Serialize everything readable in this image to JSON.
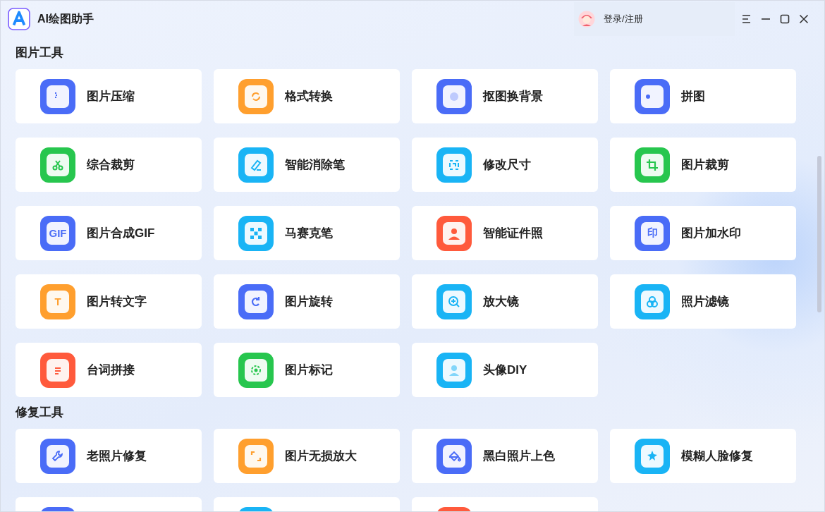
{
  "window": {
    "title": "AI绘图助手"
  },
  "account": {
    "label": "登录/注册"
  },
  "sections": [
    {
      "title": "图片工具",
      "tools": [
        {
          "label": "图片压缩",
          "color": "#4a6cf7",
          "kind": "file"
        },
        {
          "label": "格式转换",
          "color": "#ff9f2e",
          "kind": "refresh"
        },
        {
          "label": "抠图换背景",
          "color": "#4a6cf7",
          "kind": "cutout"
        },
        {
          "label": "拼图",
          "color": "#4a6cf7",
          "kind": "puzzle"
        },
        {
          "label": "综合裁剪",
          "color": "#27c64e",
          "kind": "scissors"
        },
        {
          "label": "智能消除笔",
          "color": "#19b4f5",
          "kind": "eraser"
        },
        {
          "label": "修改尺寸",
          "color": "#19b4f5",
          "kind": "resize"
        },
        {
          "label": "图片裁剪",
          "color": "#27c64e",
          "kind": "crop"
        },
        {
          "label": "图片合成GIF",
          "color": "#4a6cf7",
          "kind": "glyph",
          "glyph": "GIF"
        },
        {
          "label": "马赛克笔",
          "color": "#19b4f5",
          "kind": "mosaic"
        },
        {
          "label": "智能证件照",
          "color": "#ff5a3c",
          "kind": "person"
        },
        {
          "label": "图片加水印",
          "color": "#4a6cf7",
          "kind": "glyph",
          "glyph": "印"
        },
        {
          "label": "图片转文字",
          "color": "#ff9f2e",
          "kind": "glyph",
          "glyph": "T"
        },
        {
          "label": "图片旋转",
          "color": "#4a6cf7",
          "kind": "rotate"
        },
        {
          "label": "放大镜",
          "color": "#19b4f5",
          "kind": "zoom"
        },
        {
          "label": "照片滤镜",
          "color": "#19b4f5",
          "kind": "filter"
        },
        {
          "label": "台词拼接",
          "color": "#ff5a3c",
          "kind": "doc"
        },
        {
          "label": "图片标记",
          "color": "#27c64e",
          "kind": "target"
        },
        {
          "label": "头像DIY",
          "color": "#19b4f5",
          "kind": "avatar"
        }
      ]
    },
    {
      "title": "修复工具",
      "tools": [
        {
          "label": "老照片修复",
          "color": "#4a6cf7",
          "kind": "wrench"
        },
        {
          "label": "图片无损放大",
          "color": "#ff9f2e",
          "kind": "expand"
        },
        {
          "label": "黑白照片上色",
          "color": "#4a6cf7",
          "kind": "bucket"
        },
        {
          "label": "模糊人脸修复",
          "color": "#19b4f5",
          "kind": "sparkle"
        },
        {
          "color": "#4a6cf7",
          "kind": "cut"
        },
        {
          "color": "#19b4f5",
          "kind": "cut"
        },
        {
          "color": "#ff5a3c",
          "kind": "cut"
        }
      ]
    }
  ]
}
